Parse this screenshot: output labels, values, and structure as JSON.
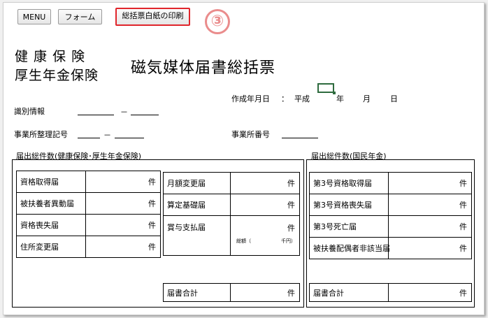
{
  "toolbar": {
    "menu_label": "MENU",
    "form_label": "フォーム",
    "print_label": "総括票白紙の印刷",
    "step_marker": "③"
  },
  "header": {
    "insurance_line1": "健 康 保 険",
    "insurance_line2": "厚生年金保険",
    "form_title": "磁気媒体届書総括票",
    "created_date_label": "作成年月日",
    "colon": "：",
    "era": "平成",
    "year_unit": "年",
    "month_unit": "月",
    "day_unit": "日"
  },
  "identification": {
    "id_info_label": "識別情報",
    "office_code_label": "事業所整理記号",
    "office_number_label": "事業所番号",
    "dash": "－"
  },
  "health_section": {
    "title": "届出総件数(健康保険･厚生年金保険)",
    "left_rows": [
      {
        "label": "資格取得届",
        "unit": "件"
      },
      {
        "label": "被扶養者異動届",
        "unit": "件"
      },
      {
        "label": "資格喪失届",
        "unit": "件"
      },
      {
        "label": "住所変更届",
        "unit": "件"
      }
    ],
    "right_rows": [
      {
        "label": "月額変更届",
        "unit": "件"
      },
      {
        "label": "算定基礎届",
        "unit": "件"
      },
      {
        "label": "賞与支払届",
        "unit": "件",
        "total_label": "総額（",
        "total_unit": "千円）"
      }
    ],
    "total": {
      "label": "届書合計",
      "unit": "件"
    }
  },
  "pension_section": {
    "title": "届出総件数(国民年金)",
    "rows": [
      {
        "label": "第3号資格取得届",
        "unit": "件"
      },
      {
        "label": "第3号資格喪失届",
        "unit": "件"
      },
      {
        "label": "第3号死亡届",
        "unit": "件"
      },
      {
        "label": "被扶養配偶者非該当届",
        "unit": "件"
      }
    ],
    "total": {
      "label": "届書合計",
      "unit": "件"
    }
  },
  "colors": {
    "highlight": "#e0252b",
    "step_marker": "#ea8c8c",
    "cell_cursor": "#2e6b3e"
  }
}
